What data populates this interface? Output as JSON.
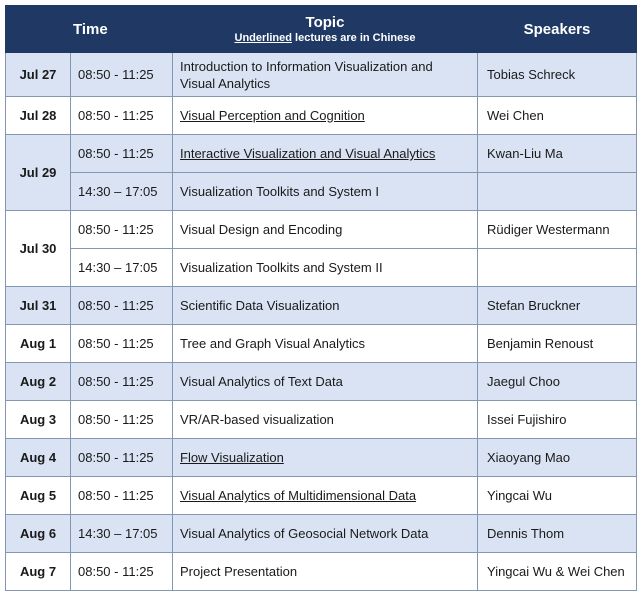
{
  "header": {
    "time": "Time",
    "topic": "Topic",
    "topic_note_underlined": "Underlined",
    "topic_note_rest": " lectures are in Chinese",
    "speakers": "Speakers"
  },
  "rows": [
    {
      "date": "Jul 27",
      "time": "08:50 - 11:25",
      "topic": "Introduction to Information Visualization and Visual Analytics",
      "underlined": false,
      "speaker": "Tobias Schreck"
    },
    {
      "date": "Jul 28",
      "time": "08:50 - 11:25",
      "topic": "Visual Perception and Cognition",
      "underlined": true,
      "speaker": "Wei Chen"
    },
    {
      "date": "Jul 29",
      "time": "08:50 - 11:25",
      "topic": "Interactive Visualization and Visual Analytics",
      "underlined": true,
      "speaker": "Kwan-Liu Ma"
    },
    {
      "date": "",
      "time": "14:30 – 17:05",
      "topic": "Visualization Toolkits and System I",
      "underlined": false,
      "speaker": ""
    },
    {
      "date": "Jul 30",
      "time": "08:50 - 11:25",
      "topic": "Visual Design and Encoding",
      "underlined": false,
      "speaker": "Rüdiger Westermann"
    },
    {
      "date": "",
      "time": "14:30 – 17:05",
      "topic": "Visualization Toolkits and System II",
      "underlined": false,
      "speaker": ""
    },
    {
      "date": "Jul 31",
      "time": "08:50 - 11:25",
      "topic": "Scientific Data Visualization",
      "underlined": false,
      "speaker": "Stefan Bruckner"
    },
    {
      "date": "Aug 1",
      "time": "08:50 - 11:25",
      "topic": "Tree and Graph Visual Analytics",
      "underlined": false,
      "speaker": "Benjamin Renoust"
    },
    {
      "date": "Aug 2",
      "time": "08:50 - 11:25",
      "topic": "Visual Analytics of Text Data",
      "underlined": false,
      "speaker": "Jaegul Choo"
    },
    {
      "date": "Aug 3",
      "time": "08:50 - 11:25",
      "topic": "VR/AR-based visualization",
      "underlined": false,
      "speaker": "Issei Fujishiro"
    },
    {
      "date": "Aug 4",
      "time": "08:50 - 11:25",
      "topic": "Flow Visualization",
      "underlined": true,
      "speaker": "Xiaoyang Mao"
    },
    {
      "date": "Aug 5",
      "time": "08:50 - 11:25",
      "topic": "Visual Analytics of Multidimensional Data",
      "underlined": true,
      "speaker": "Yingcai Wu"
    },
    {
      "date": "Aug 6",
      "time": "14:30 – 17:05",
      "topic": "Visual Analytics of Geosocial Network Data",
      "underlined": false,
      "speaker": "Dennis Thom"
    },
    {
      "date": "Aug 7",
      "time": "08:50 - 11:25",
      "topic": "Project Presentation",
      "underlined": false,
      "speaker": "Yingcai Wu & Wei Chen"
    }
  ],
  "colors": {
    "header_bg": "#1f3864",
    "shade_bg": "#dae3f3",
    "border": "#8497b0"
  }
}
